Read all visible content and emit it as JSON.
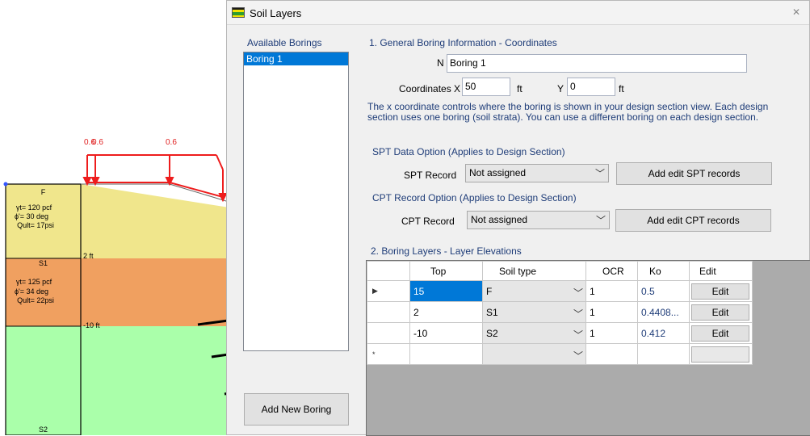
{
  "section": {
    "load_labels": [
      "0.6",
      "0.6",
      "0.6"
    ],
    "layers": [
      {
        "name": "F",
        "lines": [
          "γt= 120 pcf",
          "ϕ'= 30 deg",
          "Qult= 17psi"
        ],
        "color": "#f0e68c"
      },
      {
        "name": "S1",
        "lines": [
          "γt= 125 pcf",
          "ϕ'= 34 deg",
          "Qult= 22psi"
        ],
        "color": "#f0a060"
      },
      {
        "name": "S2",
        "lines": [],
        "color": "#aaffaa"
      }
    ],
    "elevations": [
      "2 ft",
      "-10 ft"
    ]
  },
  "dialog": {
    "title": "Soil Layers",
    "close_icon": "close-icon",
    "available_borings_label": "Available Borings",
    "borings": [
      "Boring 1"
    ],
    "add_new_boring": "Add New Boring",
    "general": {
      "group_label": "1. General Boring Information - Coordinates",
      "name_label": "N",
      "name_value": "Boring 1",
      "coords_label": "Coordinates X",
      "x_value": "50",
      "x_unit": "ft",
      "y_label": "Y",
      "y_value": "0",
      "y_unit": "ft",
      "note": "The x coordinate controls where the boring is shown in your design section view. Each design section uses one boring (soil strata). You can use a different boring on each design section."
    },
    "spt": {
      "group_label": "SPT Data Option (Applies to Design Section)",
      "label": "SPT Record",
      "value": "Not assigned",
      "button": "Add edit SPT records"
    },
    "cpt": {
      "group_label": "CPT Record Option (Applies to Design Section)",
      "label": "CPT Record",
      "value": "Not assigned",
      "button": "Add edit CPT records"
    },
    "layers": {
      "group_label": "2. Boring Layers - Layer Elevations",
      "columns": [
        "Top",
        "Soil type",
        "OCR",
        "Ko",
        "Edit"
      ],
      "rows": [
        {
          "marker": "▶",
          "top": "15",
          "soil": "F",
          "ocr": "1",
          "ko": "0.5",
          "edit": "Edit"
        },
        {
          "marker": "",
          "top": "2",
          "soil": "S1",
          "ocr": "1",
          "ko": "0.4408...",
          "edit": "Edit"
        },
        {
          "marker": "",
          "top": "-10",
          "soil": "S2",
          "ocr": "1",
          "ko": "0.412",
          "edit": "Edit"
        }
      ],
      "new_row_marker": "*"
    }
  }
}
